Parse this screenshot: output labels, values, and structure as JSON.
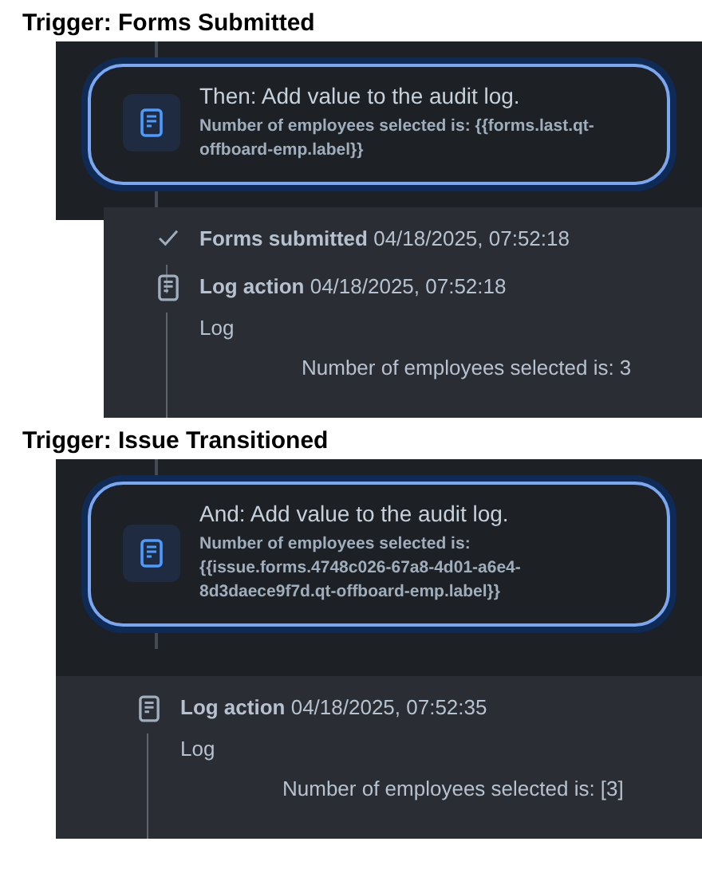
{
  "sections": [
    {
      "title": "Trigger: Forms Submitted",
      "card": {
        "heading": "Then: Add value to the audit log.",
        "detail": "Number of employees selected is: {{forms.last.qt-offboard-emp.label}}"
      },
      "entries": [
        {
          "kind": "check",
          "label": "Forms submitted",
          "time": "04/18/2025, 07:52:18"
        },
        {
          "kind": "log",
          "label": "Log action",
          "time": "04/18/2025, 07:52:18",
          "body": "Log",
          "message": "Number of employees selected is: 3"
        }
      ]
    },
    {
      "title": "Trigger: Issue Transitioned",
      "card": {
        "heading": "And: Add value to the audit log.",
        "detail": "Number of employees selected is: {{issue.forms.4748c026-67a8-4d01-a6e4-8d3daece9f7d.qt-offboard-emp.label}}"
      },
      "entries": [
        {
          "kind": "log",
          "label": "Log action",
          "time": "04/18/2025, 07:52:35",
          "body": "Log",
          "message": "Number of employees selected is: [3]"
        }
      ]
    }
  ]
}
